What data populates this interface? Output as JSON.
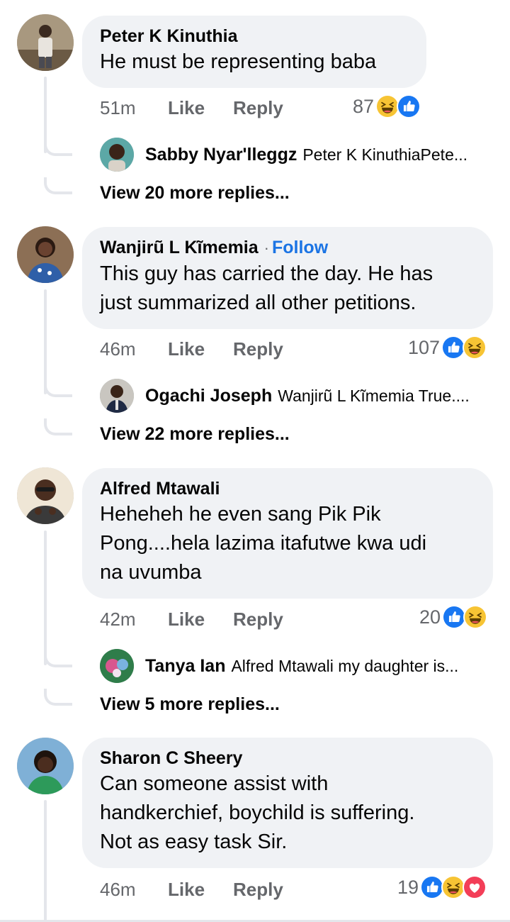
{
  "comments": [
    {
      "author": "Peter K Kinuthia",
      "text_lines": [
        "He must be representing baba"
      ],
      "time": "51m",
      "like_label": "Like",
      "reply_label": "Reply",
      "reaction_count": "87",
      "reactions": [
        "haha-icon",
        "like-icon"
      ],
      "reply_preview": {
        "name": "Sabby Nyar'lleggz",
        "snippet": "Peter K KinuthiaPete..."
      },
      "view_more": "View 20 more replies..."
    },
    {
      "author": "Wanjirũ L Kĩmemia",
      "follow_sep": "·",
      "follow": "Follow",
      "text_lines": [
        "This guy has carried the day. He has",
        "just summarized all other petitions."
      ],
      "time": "46m",
      "like_label": "Like",
      "reply_label": "Reply",
      "reaction_count": "107",
      "reactions": [
        "like-icon",
        "haha-icon"
      ],
      "reply_preview": {
        "name": "Ogachi Joseph",
        "snippet": "Wanjirũ L Kĩmemia True...."
      },
      "view_more": "View 22 more replies..."
    },
    {
      "author": "Alfred Mtawali",
      "text_lines": [
        "Heheheh he even sang Pik Pik",
        "Pong....hela lazima itafutwe kwa udi",
        "na uvumba"
      ],
      "time": "42m",
      "like_label": "Like",
      "reply_label": "Reply",
      "reaction_count": "20",
      "reactions": [
        "like-icon",
        "haha-icon"
      ],
      "reply_preview": {
        "name": "Tanya Ian",
        "snippet": "Alfred Mtawali my daughter is..."
      },
      "view_more": "View 5 more replies..."
    },
    {
      "author": "Sharon C Sheery",
      "text_lines": [
        "Can someone assist with",
        "handkerchief, boychild is suffering.",
        "Not as easy task Sir."
      ],
      "time": "46m",
      "like_label": "Like",
      "reply_label": "Reply",
      "reaction_count": "19",
      "reactions": [
        "like-icon",
        "haha-icon",
        "love-icon"
      ]
    }
  ],
  "colors": {
    "bubble": "#f0f2f5",
    "meta_text": "#65676b",
    "follow_blue": "#1b74e4",
    "like_blue": "#1877f2",
    "haha_yellow": "#f7c434",
    "love_red": "#f33e58",
    "thread_line": "#e4e6eb"
  }
}
